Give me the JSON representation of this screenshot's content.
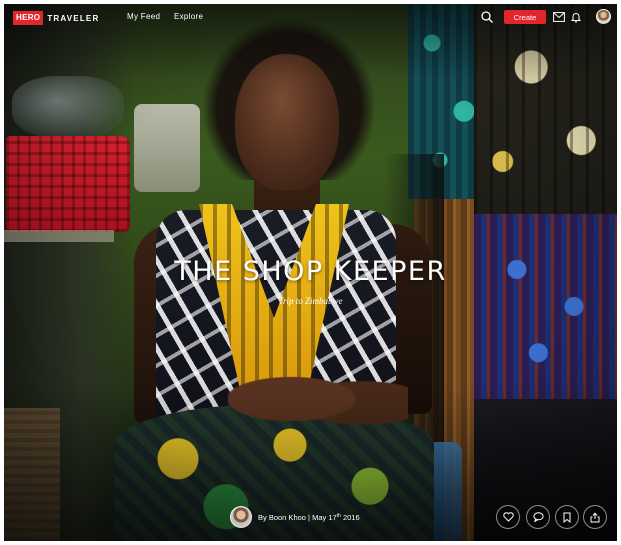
{
  "brand": {
    "badge": "HERO",
    "wordmark": "TRAVELER",
    "accent": "#e2262c"
  },
  "nav": {
    "links": [
      "My Feed",
      "Explore"
    ],
    "create_label": "Create",
    "icons": [
      "search-icon",
      "mail-icon",
      "bell-icon",
      "user-avatar"
    ]
  },
  "story": {
    "title": "THE SHOP KEEPER",
    "subtitle": "Trip to Zimbabwe",
    "author": "By Boon Khoo",
    "separator": "|",
    "date_prefix": "May 17",
    "date_suffix": "th",
    "year": "2016"
  },
  "actions": [
    "heart-icon",
    "comment-icon",
    "bookmark-icon",
    "share-icon"
  ]
}
